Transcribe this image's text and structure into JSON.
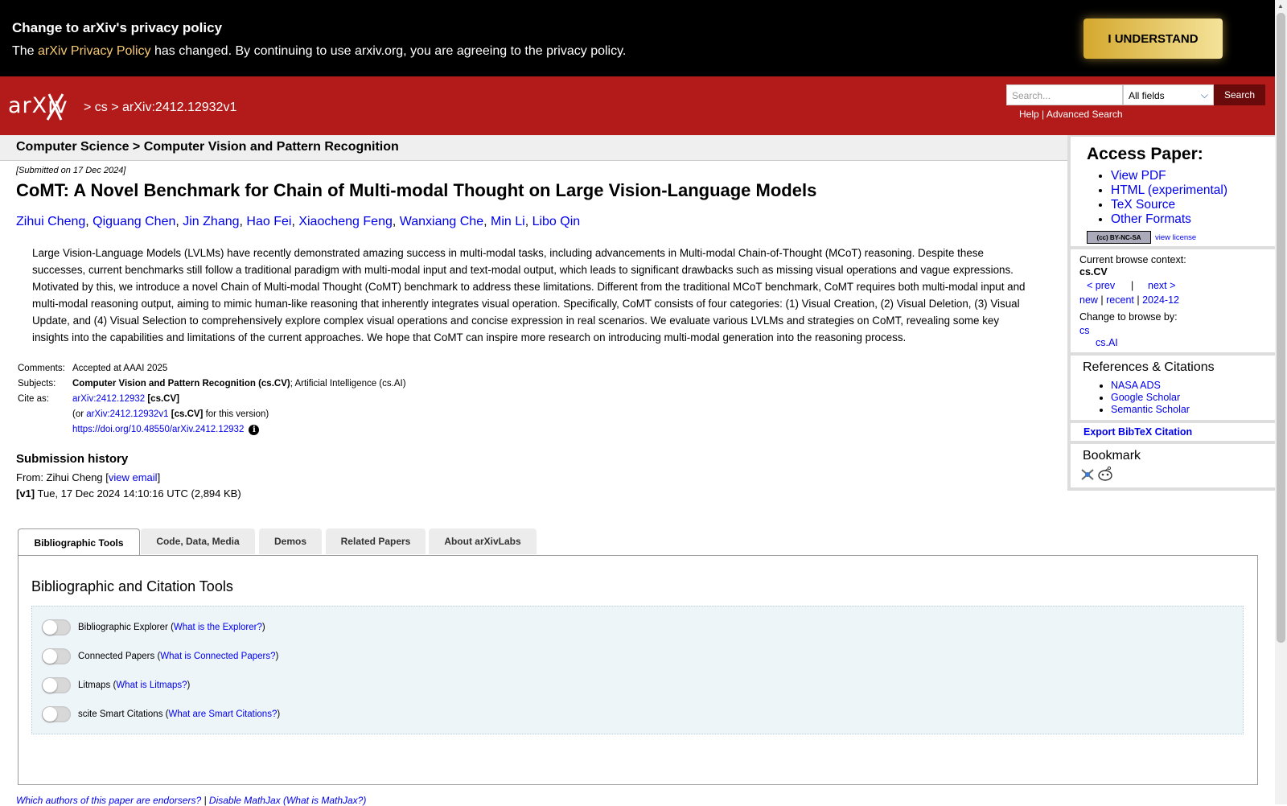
{
  "privacy": {
    "title": "Change to arXiv's privacy policy",
    "msg_pre": "The ",
    "policy_link": "arXiv Privacy Policy",
    "msg_post": " has changed. By continuing to use arxiv.org, you are agreeing to the privacy policy.",
    "button": "I UNDERSTAND"
  },
  "header": {
    "logo": "arXiv",
    "breadcrumb": "> cs > arXiv:2412.12932v1",
    "search_placeholder": "Search...",
    "field_selected": "All fields",
    "search_button": "Search",
    "help": "Help",
    "sep": " | ",
    "advanced": "Advanced Search"
  },
  "subheader": "Computer Science > Computer Vision and Pattern Recognition",
  "paper": {
    "dateline": "[Submitted on 17 Dec 2024]",
    "title": "CoMT: A Novel Benchmark for Chain of Multi-modal Thought on Large Vision-Language Models",
    "authors": [
      "Zihui Cheng",
      "Qiguang Chen",
      "Jin Zhang",
      "Hao Fei",
      "Xiaocheng Feng",
      "Wanxiang Che",
      "Min Li",
      "Libo Qin"
    ],
    "abstract": "Large Vision-Language Models (LVLMs) have recently demonstrated amazing success in multi-modal tasks, including advancements in Multi-modal Chain-of-Thought (MCoT) reasoning. Despite these successes, current benchmarks still follow a traditional paradigm with multi-modal input and text-modal output, which leads to significant drawbacks such as missing visual operations and vague expressions. Motivated by this, we introduce a novel Chain of Multi-modal Thought (CoMT) benchmark to address these limitations. Different from the traditional MCoT benchmark, CoMT requires both multi-modal input and multi-modal reasoning output, aiming to mimic human-like reasoning that inherently integrates visual operation. Specifically, CoMT consists of four categories: (1) Visual Creation, (2) Visual Deletion, (3) Visual Update, and (4) Visual Selection to comprehensively explore complex visual operations and concise expression in real scenarios. We evaluate various LVLMs and strategies on CoMT, revealing some key insights into the capabilities and limitations of the current approaches. We hope that CoMT can inspire more research on introducing multi-modal generation into the reasoning process.",
    "meta": {
      "comments_label": "Comments:",
      "comments": "Accepted at AAAI 2025",
      "subjects_label": "Subjects:",
      "subject_primary": "Computer Vision and Pattern Recognition (cs.CV)",
      "subject_rest": "; Artificial Intelligence (cs.AI)",
      "cite_label": "Cite as:",
      "cite_id": "arXiv:2412.12932",
      "cite_cat": " [cs.CV]",
      "cite_or": "(or ",
      "cite_v1": "arXiv:2412.12932v1",
      "cite_v1_cat": " [cs.CV]",
      "cite_v1_post": " for this version)",
      "doi": "https://doi.org/10.48550/arXiv.2412.12932"
    },
    "history": {
      "heading": "Submission history",
      "from_pre": "From: Zihui Cheng [",
      "view_email": "view email",
      "from_post": "]",
      "v1_tag": "[v1]",
      "v1_text": " Tue, 17 Dec 2024 14:10:16 UTC (2,894 KB)"
    }
  },
  "tabs": [
    "Bibliographic Tools",
    "Code, Data, Media",
    "Demos",
    "Related Papers",
    "About arXivLabs"
  ],
  "panel": {
    "title": "Bibliographic and Citation Tools",
    "toggles": [
      {
        "label": "Bibliographic Explorer",
        "link": "What is the Explorer?"
      },
      {
        "label": "Connected Papers",
        "link": "What is Connected Papers?"
      },
      {
        "label": "Litmaps",
        "link": "What is Litmaps?"
      },
      {
        "label": "scite Smart Citations",
        "link": "What are Smart Citations?"
      }
    ]
  },
  "footer": {
    "endorsers": "Which authors of this paper are endorsers?",
    "sep": " | ",
    "mathjax": "Disable MathJax",
    "whatmath": "(What is MathJax?)"
  },
  "sidebar": {
    "access_heading": "Access Paper:",
    "access_links": [
      "View PDF",
      "HTML (experimental)",
      "TeX Source",
      "Other Formats"
    ],
    "license_badge": "(cc) BY-NC-SA",
    "view_license": "view license",
    "browse_context_label": "Current browse context:",
    "browse_context": "cs.CV",
    "prev": "< prev",
    "pipe": "|",
    "next": "next >",
    "new": "new",
    "recent": "recent",
    "month": "2024-12",
    "change_browse": "Change to browse by:",
    "browse_cs": "cs",
    "browse_csai": "cs.AI",
    "refs_heading": "References & Citations",
    "refs": [
      "NASA ADS",
      "Google Scholar",
      "Semantic Scholar"
    ],
    "export_bibtex": "Export BibTeX Citation",
    "bookmark_heading": "Bookmark"
  },
  "colors": {
    "arxiv_red": "#b31b1b",
    "link": "#0000ee",
    "banner": "#000000",
    "button_gold": "#e2c455"
  }
}
